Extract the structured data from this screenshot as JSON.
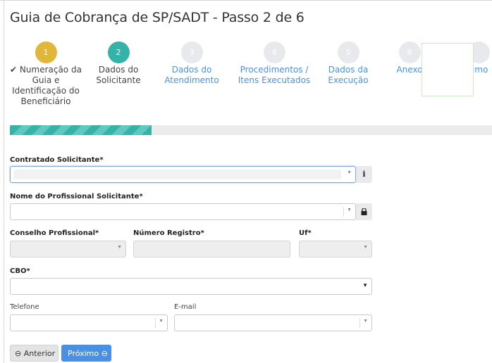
{
  "page": {
    "title": "Guia de Cobrança de SP/SADT - Passo 2 de 6"
  },
  "steps": [
    {
      "number": "1",
      "label": "✔ Numeração da Guia e Identificação do Beneficiário",
      "state": "completed"
    },
    {
      "number": "2",
      "label": "Dados do Solicitante",
      "state": "active"
    },
    {
      "number": "3",
      "label": "Dados do Atendimento",
      "state": "pending"
    },
    {
      "number": "4",
      "label": "Procedimentos / Itens Executados",
      "state": "pending"
    },
    {
      "number": "5",
      "label": "Dados da Execução",
      "state": "pending"
    },
    {
      "number": "6",
      "label": "Anexo",
      "state": "pending"
    },
    {
      "number": "",
      "label": "umo",
      "state": "pending"
    }
  ],
  "progress": {
    "fraction": 0.294
  },
  "form": {
    "contratado_label": "Contratado Solicitante*",
    "contratado_addon": "i",
    "profissional_label": "Nome do Profissional Solicitante*",
    "conselho_label": "Conselho Profissional*",
    "registro_label": "Número Registro*",
    "uf_label": "Uf*",
    "cbo_label": "CBO*",
    "telefone_label": "Telefone",
    "email_label": "E-mail"
  },
  "buttons": {
    "prev": "Anterior",
    "next": "Próximo"
  },
  "icons": {
    "prev": "arrow-left-circle-icon",
    "next": "arrow-right-circle-icon",
    "lock": "lock-icon",
    "info": "info-icon",
    "check": "check-icon"
  },
  "colors": {
    "step_done": "#e0b73a",
    "step_active": "#36b3a8",
    "step_pending": "#e8e9ed",
    "link": "#4a90e2",
    "primary_button": "#4a90e2"
  }
}
